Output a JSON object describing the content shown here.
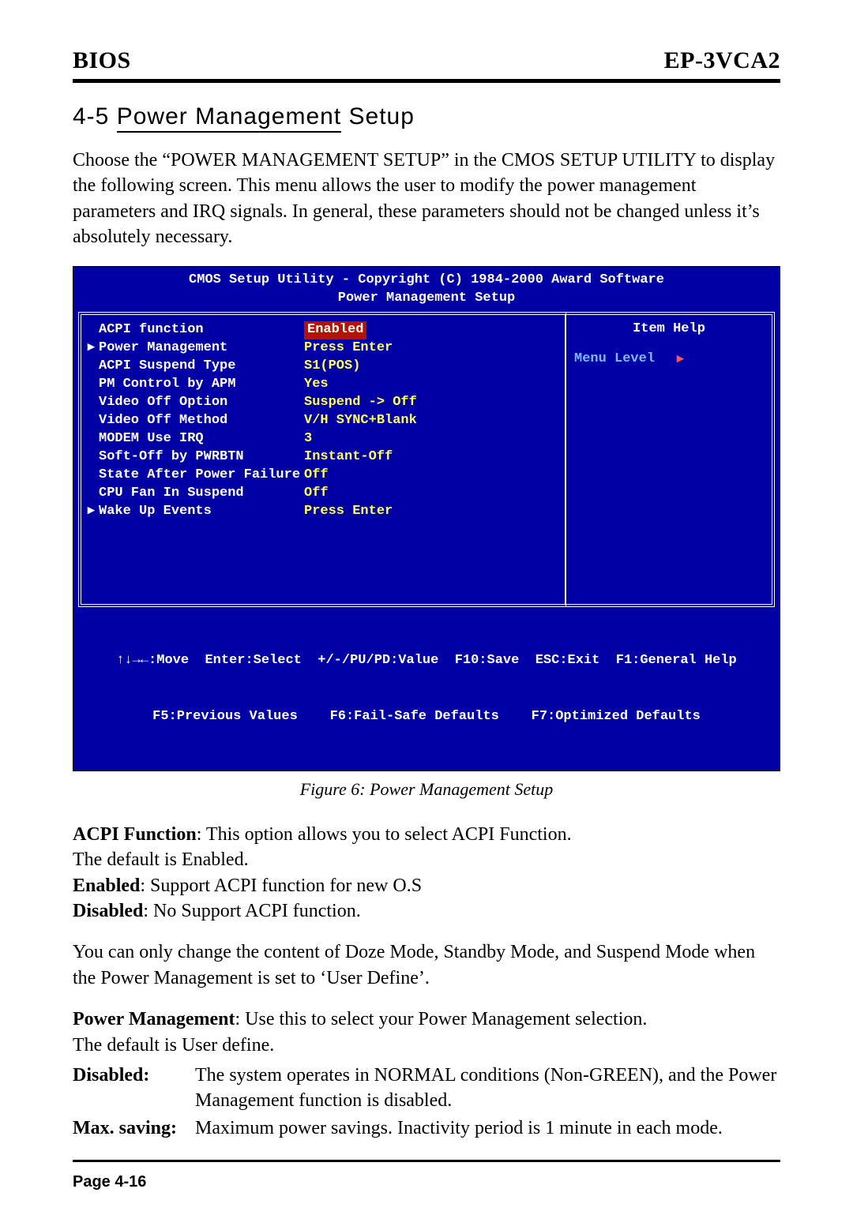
{
  "header": {
    "left": "BIOS",
    "right": "EP-3VCA2"
  },
  "section": {
    "number": "4-5",
    "title_underlined": "Power Management",
    "title_rest": " Setup"
  },
  "intro": "Choose the “POWER MANAGEMENT SETUP” in the CMOS SETUP UTILITY to display the following screen. This menu allows the user to modify the power management parameters and IRQ signals. In general, these parameters should not be changed unless it’s absolutely necessary.",
  "bios": {
    "title_line1": "CMOS Setup Utility - Copyright (C) 1984-2000 Award Software",
    "title_line2": "Power Management Setup",
    "rows": [
      {
        "arrow": " ",
        "label": "ACPI function",
        "value": "Enabled",
        "hl": true
      },
      {
        "arrow": "▸",
        "label": "Power Management",
        "value": "Press Enter",
        "hl": false
      },
      {
        "arrow": " ",
        "label": "ACPI Suspend Type",
        "value": "S1(POS)",
        "hl": false
      },
      {
        "arrow": " ",
        "label": "PM Control by APM",
        "value": "Yes",
        "hl": false
      },
      {
        "arrow": " ",
        "label": "Video Off Option",
        "value": "Suspend -> Off",
        "hl": false
      },
      {
        "arrow": " ",
        "label": "Video Off Method",
        "value": "V/H SYNC+Blank",
        "hl": false
      },
      {
        "arrow": " ",
        "label": "MODEM Use IRQ",
        "value": "3",
        "hl": false
      },
      {
        "arrow": " ",
        "label": "Soft-Off by PWRBTN",
        "value": "Instant-Off",
        "hl": false
      },
      {
        "arrow": " ",
        "label": "State After Power Failure",
        "value": "Off",
        "hl": false
      },
      {
        "arrow": " ",
        "label": "CPU Fan In Suspend",
        "value": "Off",
        "hl": false
      },
      {
        "arrow": "▸",
        "label": "Wake Up Events",
        "value": "Press Enter",
        "hl": false
      }
    ],
    "help_title": "Item Help",
    "menu_level_label": "Menu Level",
    "footer_line1": "↑↓→←:Move  Enter:Select  +/-/PU/PD:Value  F10:Save  ESC:Exit  F1:General Help",
    "footer_line2": "F5:Previous Values    F6:Fail-Safe Defaults    F7:Optimized Defaults"
  },
  "figure_caption": "Figure 6:  Power Management Setup",
  "body": {
    "acpi_label": "ACPI Function",
    "acpi_text": ": This option allows you to select ACPI Function.",
    "acpi_default": "The default is Enabled.",
    "enabled_label": "Enabled",
    "enabled_text": ":  Support ACPI function for new O.S",
    "disabled_label": "Disabled",
    "disabled_text": ": No Support ACPI function.",
    "doze_para": "You can only change the content of Doze Mode, Standby Mode, and Suspend Mode when the Power Management is set to ‘User Define’.",
    "pm_label": "Power Management",
    "pm_text": ": Use this to select your Power Management selection.",
    "pm_default": "The default is User define.",
    "defs": [
      {
        "term": "Disabled:",
        "desc": "The system operates in NORMAL conditions (Non-GREEN), and the Power Management function is disabled."
      },
      {
        "term": "Max. saving:",
        "desc": "Maximum power savings. Inactivity period is 1 minute in each mode."
      }
    ]
  },
  "page_footer": "Page 4-16"
}
